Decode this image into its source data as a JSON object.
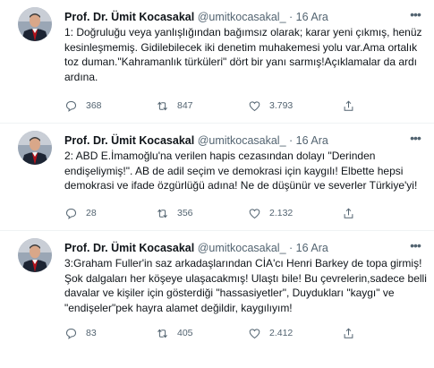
{
  "author": {
    "name": "Prof. Dr. Ümit Kocasakal",
    "handle": "@umitkocasakal_"
  },
  "separator": "·",
  "more_icon": "more-horizontal-icon",
  "tweets": [
    {
      "date": "16 Ara",
      "text": "1: Doğruluğu veya yanlışlığından bağımsız olarak; karar yeni çıkmış, henüz kesinleşmemiş. Gidilebilecek iki denetim muhakemesi yolu var.Ama ortalık toz duman.\"Kahramanlık türküleri\" dört bir yanı sarmış!Açıklamalar da ardı ardına.",
      "replies": "368",
      "retweets": "847",
      "likes": "3.793"
    },
    {
      "date": "16 Ara",
      "text": "2: ABD E.İmamoğlu'na verilen hapis cezasından dolayı \"Derinden endişeliymiş!\". AB de adil seçim ve demokrasi için kaygılı! Elbette hepsi demokrasi ve ifade özgürlüğü adına! Ne de düşünür ve severler Türkiye'yi!",
      "replies": "28",
      "retweets": "356",
      "likes": "2.132"
    },
    {
      "date": "16 Ara",
      "text": "3:Graham Fuller'in saz arkadaşlarından CİA'cı Henri Barkey de topa girmiş! Şok dalgaları her köşeye ulaşacakmış! Ulaştı bile! Bu çevrelerin,sadece belli davalar ve kişiler için gösterdiği \"hassasiyetler\", Duydukları \"kaygı\" ve \"endişeler\"pek hayra alamet değildir, kaygılıyım!",
      "replies": "83",
      "retweets": "405",
      "likes": "2.412"
    }
  ]
}
